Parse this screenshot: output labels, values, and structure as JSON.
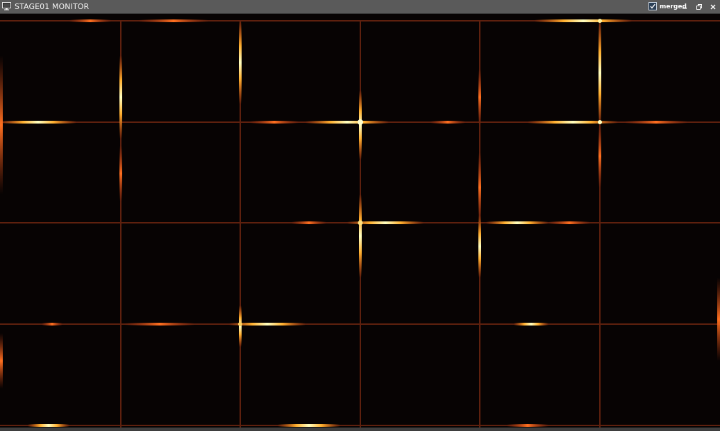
{
  "window": {
    "title": "STAGE01 MONITOR",
    "icon": "monitor-icon"
  },
  "titlebar_controls": {
    "merged_label": "merged",
    "merged_checked": true,
    "minimize_icon": "minimize-icon",
    "restore_icon": "restore-icon",
    "close_icon": "close-icon"
  },
  "monitor": {
    "columns": 6,
    "rows": 4,
    "background_color": "#070303",
    "line_color": "#6a2410",
    "hot_colors": [
      "#b83a10",
      "#ff7a20",
      "#ffe060",
      "#ffffe0"
    ]
  },
  "colors": {
    "titlebar": "#5a5a5a",
    "titlebar_text": "#f2f2f2",
    "checkbox_fill": "#2b3f56"
  }
}
